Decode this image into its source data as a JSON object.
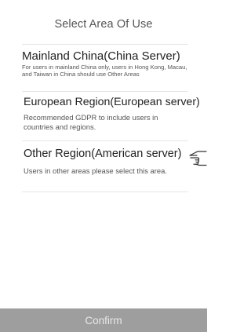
{
  "header": {
    "title": "Select Area Of Use"
  },
  "options": [
    {
      "title": "Mainland China(China Server)",
      "description": "For users in mainland China only, users in Hong Kong, Macau, and Taiwan in China should use Other Areas"
    },
    {
      "title": "European Region(European server)",
      "description": "Recommended GDPR to include users in countries and regions."
    },
    {
      "title": "Other Region(American server)",
      "description": "Users in other areas please select this area.",
      "selected": true
    }
  ],
  "footer": {
    "confirm_label": "Confirm"
  },
  "colors": {
    "confirm_bg": "#9e9e9e",
    "confirm_text": "#e8e8e8",
    "divider": "#e6e6e6"
  },
  "icons": {
    "selection_indicator": "pointing-hand-icon"
  }
}
